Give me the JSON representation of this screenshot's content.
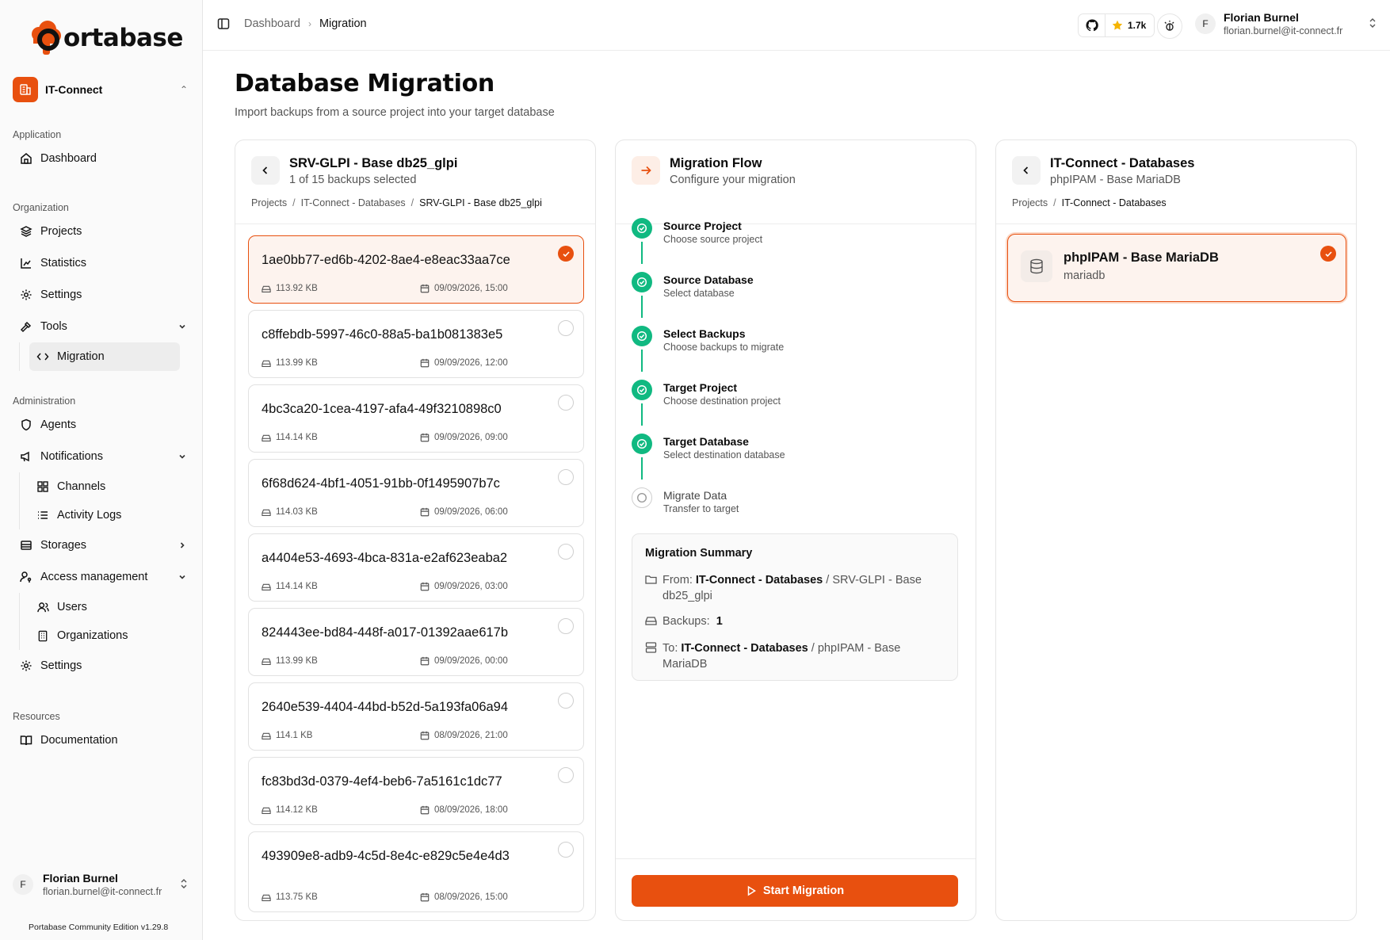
{
  "brand": {
    "name": "ortabase",
    "accent": "#e8500f",
    "success": "#10b981"
  },
  "sidebar": {
    "org": {
      "name": "IT-Connect"
    },
    "groups": [
      {
        "label": "Application",
        "items": [
          {
            "label": "Dashboard",
            "icon": "home-icon"
          }
        ]
      },
      {
        "label": "Organization",
        "items": [
          {
            "label": "Projects",
            "icon": "layers-icon"
          },
          {
            "label": "Statistics",
            "icon": "chart-icon"
          },
          {
            "label": "Settings",
            "icon": "gear-icon"
          },
          {
            "label": "Tools",
            "icon": "hammer-icon",
            "expanded": true,
            "children": [
              {
                "label": "Migration",
                "icon": "code-icon",
                "active": true
              }
            ]
          }
        ]
      },
      {
        "label": "Administration",
        "items": [
          {
            "label": "Agents",
            "icon": "shield-icon"
          },
          {
            "label": "Notifications",
            "icon": "megaphone-icon",
            "expanded": true,
            "children": [
              {
                "label": "Channels",
                "icon": "grid-icon"
              },
              {
                "label": "Activity Logs",
                "icon": "list-icon"
              }
            ]
          },
          {
            "label": "Storages",
            "icon": "storage-icon"
          },
          {
            "label": "Access management",
            "icon": "user-key-icon",
            "expanded": true,
            "children": [
              {
                "label": "Users",
                "icon": "users-icon"
              },
              {
                "label": "Organizations",
                "icon": "building-icon"
              }
            ]
          },
          {
            "label": "Settings",
            "icon": "gear-icon"
          }
        ]
      },
      {
        "label": "Resources",
        "items": [
          {
            "label": "Documentation",
            "icon": "book-icon"
          }
        ]
      }
    ],
    "user": {
      "initial": "F",
      "name": "Florian Burnel",
      "email": "florian.burnel@it-connect.fr"
    },
    "version": "Portabase Community Edition v1.29.8"
  },
  "topbar": {
    "breadcrumb": [
      "Dashboard",
      "Migration"
    ],
    "github_stars": "1.7k",
    "user": {
      "initial": "F",
      "name": "Florian Burnel",
      "email": "florian.burnel@it-connect.fr"
    }
  },
  "page": {
    "title": "Database Migration",
    "subtitle": "Import backups from a source project into your target database"
  },
  "source_panel": {
    "title": "SRV-GLPI - Base db25_glpi",
    "subtitle": "1 of 15 backups selected",
    "breadcrumb": [
      "Projects",
      "IT-Connect - Databases",
      "SRV-GLPI - Base db25_glpi"
    ],
    "backups": [
      {
        "id": "1ae0bb77-ed6b-4202-8ae4-e8eac33aa7ce",
        "size": "113.92 KB",
        "date": "09/09/2026, 15:00",
        "selected": true
      },
      {
        "id": "c8ffebdb-5997-46c0-88a5-ba1b081383e5",
        "size": "113.99 KB",
        "date": "09/09/2026, 12:00",
        "selected": false
      },
      {
        "id": "4bc3ca20-1cea-4197-afa4-49f3210898c0",
        "size": "114.14 KB",
        "date": "09/09/2026, 09:00",
        "selected": false
      },
      {
        "id": "6f68d624-4bf1-4051-91bb-0f1495907b7c",
        "size": "114.03 KB",
        "date": "09/09/2026, 06:00",
        "selected": false
      },
      {
        "id": "a4404e53-4693-4bca-831a-e2af623eaba2",
        "size": "114.14 KB",
        "date": "09/09/2026, 03:00",
        "selected": false
      },
      {
        "id": "824443ee-bd84-448f-a017-01392aae617b",
        "size": "113.99 KB",
        "date": "09/09/2026, 00:00",
        "selected": false
      },
      {
        "id": "2640e539-4404-44bd-b52d-5a193fa06a94",
        "size": "114.1 KB",
        "date": "08/09/2026, 21:00",
        "selected": false
      },
      {
        "id": "fc83bd3d-0379-4ef4-beb6-7a5161c1dc77",
        "size": "114.12 KB",
        "date": "08/09/2026, 18:00",
        "selected": false
      },
      {
        "id": "493909e8-adb9-4c5d-8e4c-e829c5e4e4d3",
        "size": "113.75 KB",
        "date": "08/09/2026, 15:00",
        "selected": false
      }
    ]
  },
  "flow_panel": {
    "title": "Migration Flow",
    "subtitle": "Configure your migration",
    "steps": [
      {
        "title": "Source Project",
        "desc": "Choose source project",
        "done": true
      },
      {
        "title": "Source Database",
        "desc": "Select database",
        "done": true
      },
      {
        "title": "Select Backups",
        "desc": "Choose backups to migrate",
        "done": true
      },
      {
        "title": "Target Project",
        "desc": "Choose destination project",
        "done": true
      },
      {
        "title": "Target Database",
        "desc": "Select destination database",
        "done": true
      },
      {
        "title": "Migrate Data",
        "desc": "Transfer to target",
        "done": false
      }
    ],
    "summary": {
      "title": "Migration Summary",
      "from_label": "From:",
      "from_project": "IT-Connect - Databases",
      "from_db": "SRV-GLPI - Base db25_glpi",
      "backups_label": "Backups:",
      "backups_count": "1",
      "to_label": "To:",
      "to_project": "IT-Connect - Databases",
      "to_db": "phpIPAM - Base MariaDB"
    },
    "start_button": "Start Migration"
  },
  "target_panel": {
    "title": "IT-Connect - Databases",
    "subtitle": "phpIPAM - Base MariaDB",
    "breadcrumb": [
      "Projects",
      "IT-Connect - Databases"
    ],
    "database": {
      "name": "phpIPAM - Base MariaDB",
      "engine": "mariadb",
      "selected": true
    }
  }
}
